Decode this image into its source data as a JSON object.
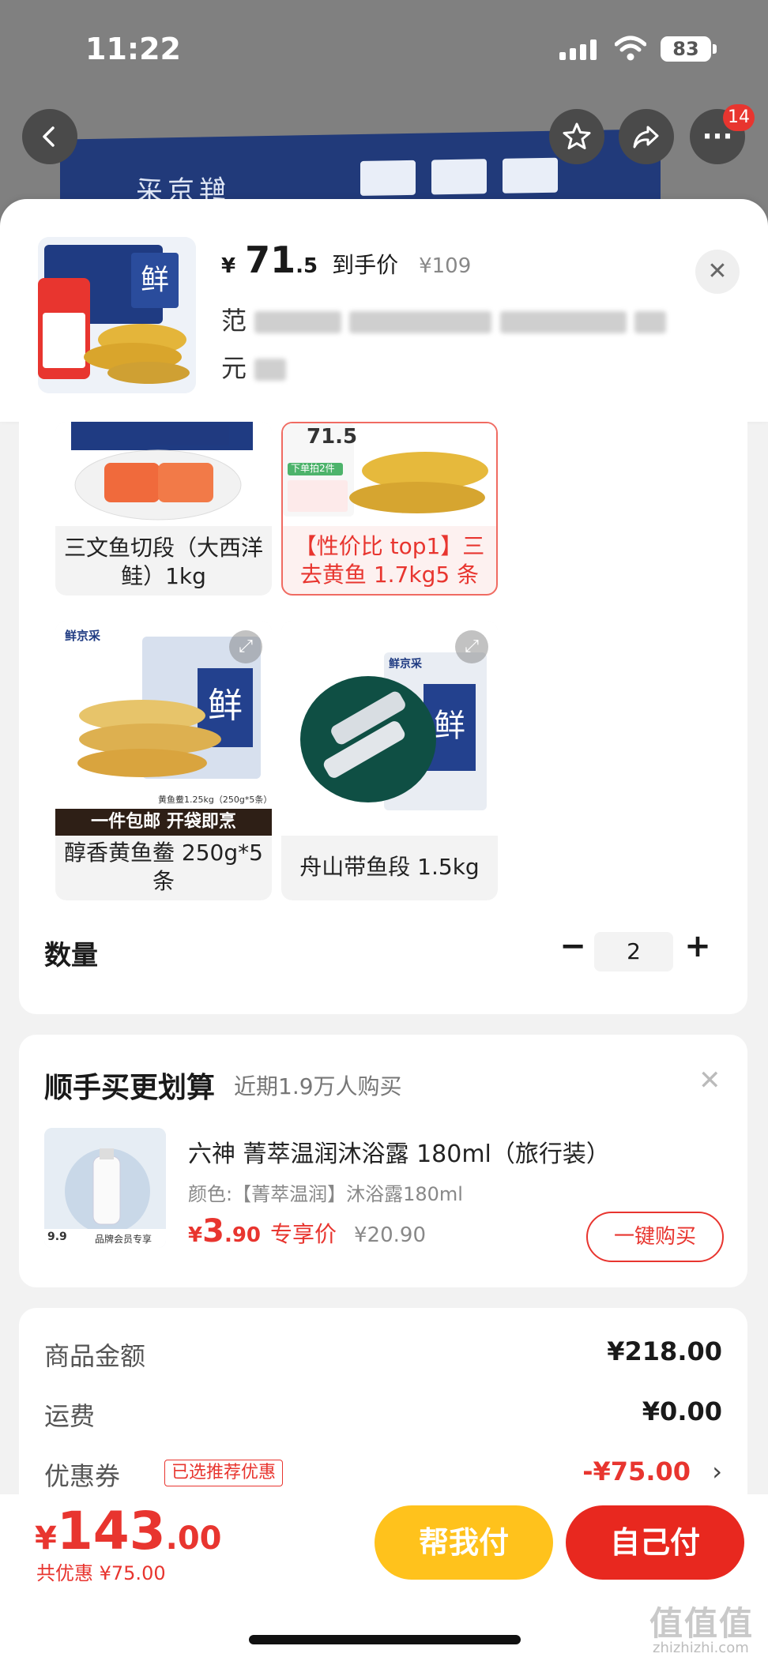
{
  "status_bar": {
    "time": "11:22",
    "battery": "83"
  },
  "nav": {
    "more_badge": "14"
  },
  "product": {
    "currency": "¥",
    "price_int": "71",
    "price_dec": ".5",
    "price_label": "到手价",
    "original_price": "¥109",
    "title_first": "范",
    "title_second": "元"
  },
  "options": [
    {
      "name": "三文鱼切段（大西洋鲑）1kg",
      "selected": false
    },
    {
      "name": "【性价比 top1】三去黄鱼 1.7kg5 条",
      "selected": true,
      "promo_price": "71.5",
      "promo_tag": "下单拍2件"
    },
    {
      "name": "醇香黄鱼鲞 250g*5 条",
      "selected": false,
      "brand": "鲜京采",
      "banner": "一件包邮 开袋即烹",
      "spec": "黄鱼鲞1.25kg（250g*5条）"
    },
    {
      "name": "舟山带鱼段 1.5kg",
      "selected": false,
      "brand": "鲜京采"
    }
  ],
  "quantity": {
    "label": "数量",
    "value": "2",
    "minus": "−",
    "plus": "+"
  },
  "recommend": {
    "title": "顺手买更划算",
    "subtitle": "近期1.9万人购买",
    "product_name": "六神 菁萃温润沐浴露 180ml（旅行装）",
    "spec": "颜色:【菁萃温润】沐浴露180ml",
    "currency": "¥",
    "price_int": "3",
    "price_dec": ".90",
    "price_tag": "专享价",
    "original_price": "¥20.90",
    "buy_label": "一键购买",
    "thumb_price": "9.9",
    "thumb_tag": "品牌会员专享"
  },
  "summary": {
    "rows": [
      {
        "label": "商品金额",
        "value": "¥218.00"
      },
      {
        "label": "运费",
        "value": "¥0.00"
      },
      {
        "label": "优惠券",
        "value": "-¥75.00",
        "tag": "已选推荐优惠"
      }
    ]
  },
  "bottom": {
    "currency": "¥",
    "total_int": "143",
    "total_dec": ".00",
    "saved": "共优惠 ¥75.00",
    "help_pay": "帮我付",
    "self_pay": "自己付"
  },
  "watermark": {
    "text": "值值值",
    "sub": "zhizhizhi.com"
  },
  "banner": {
    "text": "鲜京采"
  },
  "colors": {
    "accent_red": "#e8352f",
    "help_yellow": "#ffc21c",
    "pay_red": "#e8281f"
  }
}
